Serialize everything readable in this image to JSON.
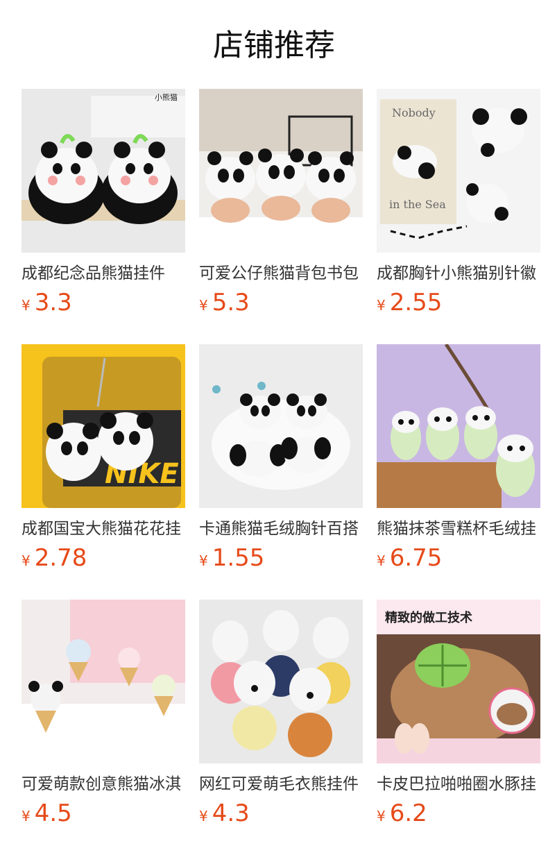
{
  "page": {
    "title": "店铺推荐"
  },
  "products": [
    {
      "name": "成都纪念品熊猫挂件",
      "currency": "¥",
      "price": "3.3",
      "image_text": "小熊猫"
    },
    {
      "name": "可爱公仔熊猫背包书包",
      "currency": "¥",
      "price": "5.3",
      "image_text": ""
    },
    {
      "name": "成都胸针小熊猫别针徽",
      "currency": "¥",
      "price": "2.55",
      "image_text": "Nobody in the Sea"
    },
    {
      "name": "成都国宝大熊猫花花挂",
      "currency": "¥",
      "price": "2.78",
      "image_text": "NIKE"
    },
    {
      "name": "卡通熊猫毛绒胸针百搭",
      "currency": "¥",
      "price": "1.55",
      "image_text": ""
    },
    {
      "name": "熊猫抹茶雪糕杯毛绒挂",
      "currency": "¥",
      "price": "6.75",
      "image_text": ""
    },
    {
      "name": "可爱萌款创意熊猫冰淇",
      "currency": "¥",
      "price": "4.5",
      "image_text": ""
    },
    {
      "name": "网红可爱萌毛衣熊挂件",
      "currency": "¥",
      "price": "4.3",
      "image_text": ""
    },
    {
      "name": "卡皮巴拉啪啪圈水豚挂",
      "currency": "¥",
      "price": "6.2",
      "image_text": "精致的做工技术"
    }
  ],
  "colors": {
    "price": "#e64a19",
    "title": "#111111",
    "name": "#333333"
  }
}
